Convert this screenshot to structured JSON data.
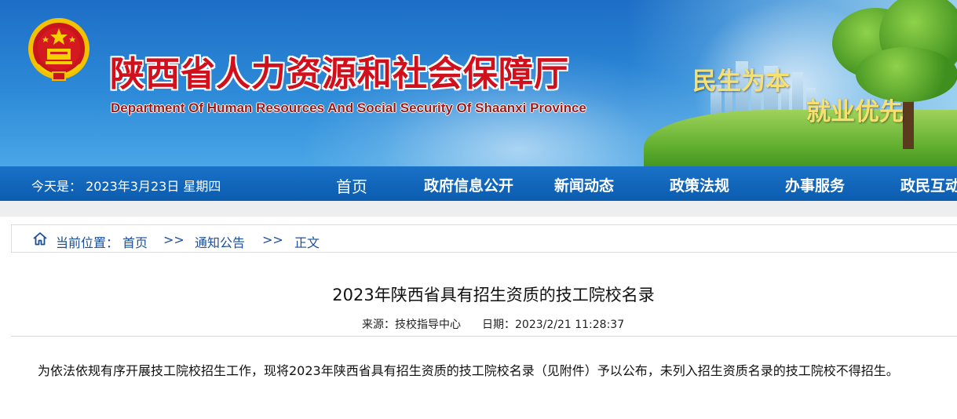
{
  "header": {
    "title": "陕西省人力资源和社会保障厅",
    "subtitle": "Department Of Human Resources And Social Security Of Shaanxi Province",
    "slogan_line1": "民生为本",
    "slogan_line2": "就业优先",
    "emblem_icon": "national-emblem-icon"
  },
  "nav": {
    "date": "今天是： 2023年3月23日 星期四",
    "items": [
      {
        "label": "首页"
      },
      {
        "label": "政府信息公开"
      },
      {
        "label": "新闻动态"
      },
      {
        "label": "政策法规"
      },
      {
        "label": "办事服务"
      },
      {
        "label": "政民互动"
      }
    ]
  },
  "breadcrumb": {
    "icon": "home-icon",
    "prefix": "当前位置：",
    "items": [
      "首页",
      "通知公告",
      "正文"
    ],
    "separator": ">>"
  },
  "article": {
    "title": "2023年陕西省具有招生资质的技工院校名录",
    "source": "来源：技校指导中心",
    "date": "日期：2023/2/21 11:28:37",
    "body": "为依法依规有序开展技工院校招生工作，现将2023年陕西省具有招生资质的技工院校名录（见附件）予以公布，未列入招生资质名录的技工院校不得招生。"
  },
  "colors": {
    "title_red": "#d0101c",
    "nav_blue": "#0b5cae",
    "link_blue": "#1b4f9a",
    "slogan_gold": "#f6e070"
  }
}
